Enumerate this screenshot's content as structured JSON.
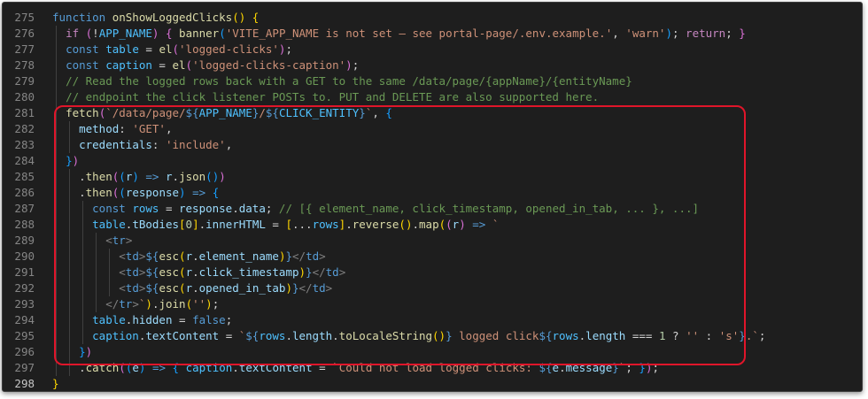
{
  "editor": {
    "current_line": "298",
    "lines": [
      {
        "n": "275",
        "tokens": [
          [
            "kw",
            "function "
          ],
          [
            "fn",
            "onShowLoggedClicks"
          ],
          [
            "p1",
            "()"
          ],
          [
            "op",
            " "
          ],
          [
            "p1",
            "{"
          ]
        ]
      },
      {
        "n": "276",
        "tokens": [
          [
            "op",
            "  "
          ],
          [
            "ctl",
            "if "
          ],
          [
            "p2",
            "("
          ],
          [
            "op",
            "!"
          ],
          [
            "cn",
            "APP_NAME"
          ],
          [
            "p2",
            ")"
          ],
          [
            "op",
            " "
          ],
          [
            "p2",
            "{"
          ],
          [
            "op",
            " "
          ],
          [
            "fn",
            "banner"
          ],
          [
            "p3",
            "("
          ],
          [
            "st",
            "'VITE_APP_NAME is not set — see portal-page/.env.example.'"
          ],
          [
            "op",
            ", "
          ],
          [
            "st",
            "'warn'"
          ],
          [
            "p3",
            ")"
          ],
          [
            "op",
            "; "
          ],
          [
            "ctl",
            "return"
          ],
          [
            "op",
            "; "
          ],
          [
            "p2",
            "}"
          ]
        ]
      },
      {
        "n": "277",
        "tokens": [
          [
            "op",
            "  "
          ],
          [
            "kw",
            "const "
          ],
          [
            "cn",
            "table"
          ],
          [
            "op",
            " = "
          ],
          [
            "fn",
            "el"
          ],
          [
            "p2",
            "("
          ],
          [
            "st",
            "'logged-clicks'"
          ],
          [
            "p2",
            ")"
          ],
          [
            "op",
            ";"
          ]
        ]
      },
      {
        "n": "278",
        "tokens": [
          [
            "op",
            "  "
          ],
          [
            "kw",
            "const "
          ],
          [
            "cn",
            "caption"
          ],
          [
            "op",
            " = "
          ],
          [
            "fn",
            "el"
          ],
          [
            "p2",
            "("
          ],
          [
            "st",
            "'logged-clicks-caption'"
          ],
          [
            "p2",
            ")"
          ],
          [
            "op",
            ";"
          ]
        ]
      },
      {
        "n": "279",
        "tokens": [
          [
            "op",
            "  "
          ],
          [
            "cm",
            "// Read the logged rows back with a GET to the same /data/page/{appName}/{entityName}"
          ]
        ]
      },
      {
        "n": "280",
        "tokens": [
          [
            "op",
            "  "
          ],
          [
            "cm",
            "// endpoint the click listener POSTs to. PUT and DELETE are also supported here."
          ]
        ]
      },
      {
        "n": "281",
        "tokens": [
          [
            "op",
            "  "
          ],
          [
            "fn",
            "fetch"
          ],
          [
            "p2",
            "("
          ],
          [
            "st",
            "`/data/page/"
          ],
          [
            "kw",
            "${"
          ],
          [
            "cn",
            "APP_NAME"
          ],
          [
            "kw",
            "}"
          ],
          [
            "st",
            "/"
          ],
          [
            "kw",
            "${"
          ],
          [
            "cn",
            "CLICK_ENTITY"
          ],
          [
            "kw",
            "}"
          ],
          [
            "st",
            "`"
          ],
          [
            "op",
            ", "
          ],
          [
            "p3",
            "{"
          ]
        ]
      },
      {
        "n": "282",
        "tokens": [
          [
            "op",
            "    "
          ],
          [
            "vr",
            "method"
          ],
          [
            "op",
            ": "
          ],
          [
            "st",
            "'GET'"
          ],
          [
            "op",
            ","
          ]
        ]
      },
      {
        "n": "283",
        "tokens": [
          [
            "op",
            "    "
          ],
          [
            "vr",
            "credentials"
          ],
          [
            "op",
            ": "
          ],
          [
            "st",
            "'include'"
          ],
          [
            "op",
            ","
          ]
        ]
      },
      {
        "n": "284",
        "tokens": [
          [
            "op",
            "  "
          ],
          [
            "p3",
            "}"
          ],
          [
            "p2",
            ")"
          ]
        ]
      },
      {
        "n": "285",
        "tokens": [
          [
            "op",
            "    ."
          ],
          [
            "fn",
            "then"
          ],
          [
            "p2",
            "("
          ],
          [
            "p3",
            "("
          ],
          [
            "vr",
            "r"
          ],
          [
            "p3",
            ")"
          ],
          [
            "op",
            " "
          ],
          [
            "kw",
            "=>"
          ],
          [
            "op",
            " "
          ],
          [
            "vr",
            "r"
          ],
          [
            "op",
            "."
          ],
          [
            "fn",
            "json"
          ],
          [
            "p3",
            "()"
          ],
          [
            "p2",
            ")"
          ]
        ]
      },
      {
        "n": "286",
        "tokens": [
          [
            "op",
            "    ."
          ],
          [
            "fn",
            "then"
          ],
          [
            "p2",
            "("
          ],
          [
            "p3",
            "("
          ],
          [
            "vr",
            "response"
          ],
          [
            "p3",
            ")"
          ],
          [
            "op",
            " "
          ],
          [
            "kw",
            "=>"
          ],
          [
            "op",
            " "
          ],
          [
            "p3",
            "{"
          ]
        ]
      },
      {
        "n": "287",
        "tokens": [
          [
            "op",
            "      "
          ],
          [
            "kw",
            "const "
          ],
          [
            "cn",
            "rows"
          ],
          [
            "op",
            " = "
          ],
          [
            "vr",
            "response"
          ],
          [
            "op",
            "."
          ],
          [
            "vr",
            "data"
          ],
          [
            "op",
            "; "
          ],
          [
            "cm",
            "// [{ element_name, click_timestamp, opened_in_tab, ... }, ...]"
          ]
        ]
      },
      {
        "n": "288",
        "tokens": [
          [
            "op",
            "      "
          ],
          [
            "cn",
            "table"
          ],
          [
            "op",
            "."
          ],
          [
            "vr",
            "tBodies"
          ],
          [
            "p1",
            "["
          ],
          [
            "nm",
            "0"
          ],
          [
            "p1",
            "]"
          ],
          [
            "op",
            "."
          ],
          [
            "vr",
            "innerHTML"
          ],
          [
            "op",
            " = "
          ],
          [
            "p1",
            "["
          ],
          [
            "op",
            "..."
          ],
          [
            "cn",
            "rows"
          ],
          [
            "p1",
            "]"
          ],
          [
            "op",
            "."
          ],
          [
            "fn",
            "reverse"
          ],
          [
            "p1",
            "()"
          ],
          [
            "op",
            "."
          ],
          [
            "fn",
            "map"
          ],
          [
            "p1",
            "("
          ],
          [
            "p2",
            "("
          ],
          [
            "vr",
            "r"
          ],
          [
            "p2",
            ")"
          ],
          [
            "op",
            " "
          ],
          [
            "kw",
            "=>"
          ],
          [
            "op",
            " "
          ],
          [
            "st",
            "`"
          ]
        ]
      },
      {
        "n": "289",
        "tokens": [
          [
            "op",
            "        "
          ],
          [
            "tgb",
            "<"
          ],
          [
            "tg",
            "tr"
          ],
          [
            "tgb",
            ">"
          ]
        ]
      },
      {
        "n": "290",
        "tokens": [
          [
            "op",
            "          "
          ],
          [
            "tgb",
            "<"
          ],
          [
            "tg",
            "td"
          ],
          [
            "tgb",
            ">"
          ],
          [
            "kw",
            "${"
          ],
          [
            "fn",
            "esc"
          ],
          [
            "p1",
            "("
          ],
          [
            "vr",
            "r"
          ],
          [
            "op",
            "."
          ],
          [
            "vr",
            "element_name"
          ],
          [
            "p1",
            ")"
          ],
          [
            "kw",
            "}"
          ],
          [
            "tgb",
            "</"
          ],
          [
            "tg",
            "td"
          ],
          [
            "tgb",
            ">"
          ]
        ]
      },
      {
        "n": "291",
        "tokens": [
          [
            "op",
            "          "
          ],
          [
            "tgb",
            "<"
          ],
          [
            "tg",
            "td"
          ],
          [
            "tgb",
            ">"
          ],
          [
            "kw",
            "${"
          ],
          [
            "fn",
            "esc"
          ],
          [
            "p1",
            "("
          ],
          [
            "vr",
            "r"
          ],
          [
            "op",
            "."
          ],
          [
            "vr",
            "click_timestamp"
          ],
          [
            "p1",
            ")"
          ],
          [
            "kw",
            "}"
          ],
          [
            "tgb",
            "</"
          ],
          [
            "tg",
            "td"
          ],
          [
            "tgb",
            ">"
          ]
        ]
      },
      {
        "n": "292",
        "tokens": [
          [
            "op",
            "          "
          ],
          [
            "tgb",
            "<"
          ],
          [
            "tg",
            "td"
          ],
          [
            "tgb",
            ">"
          ],
          [
            "kw",
            "${"
          ],
          [
            "fn",
            "esc"
          ],
          [
            "p1",
            "("
          ],
          [
            "vr",
            "r"
          ],
          [
            "op",
            "."
          ],
          [
            "vr",
            "opened_in_tab"
          ],
          [
            "p1",
            ")"
          ],
          [
            "kw",
            "}"
          ],
          [
            "tgb",
            "</"
          ],
          [
            "tg",
            "td"
          ],
          [
            "tgb",
            ">"
          ]
        ]
      },
      {
        "n": "293",
        "tokens": [
          [
            "op",
            "        "
          ],
          [
            "tgb",
            "</"
          ],
          [
            "tg",
            "tr"
          ],
          [
            "tgb",
            ">"
          ],
          [
            "st",
            "`"
          ],
          [
            "p1",
            ")"
          ],
          [
            "op",
            "."
          ],
          [
            "fn",
            "join"
          ],
          [
            "p1",
            "("
          ],
          [
            "st",
            "''"
          ],
          [
            "p1",
            ")"
          ],
          [
            "op",
            ";"
          ]
        ]
      },
      {
        "n": "294",
        "tokens": [
          [
            "op",
            "      "
          ],
          [
            "cn",
            "table"
          ],
          [
            "op",
            "."
          ],
          [
            "vr",
            "hidden"
          ],
          [
            "op",
            " = "
          ],
          [
            "kw",
            "false"
          ],
          [
            "op",
            ";"
          ]
        ]
      },
      {
        "n": "295",
        "tokens": [
          [
            "op",
            "      "
          ],
          [
            "cn",
            "caption"
          ],
          [
            "op",
            "."
          ],
          [
            "vr",
            "textContent"
          ],
          [
            "op",
            " = "
          ],
          [
            "st",
            "`"
          ],
          [
            "kw",
            "${"
          ],
          [
            "cn",
            "rows"
          ],
          [
            "op",
            "."
          ],
          [
            "vr",
            "length"
          ],
          [
            "op",
            "."
          ],
          [
            "fn",
            "toLocaleString"
          ],
          [
            "p1",
            "()"
          ],
          [
            "kw",
            "}"
          ],
          [
            "st",
            " logged click"
          ],
          [
            "kw",
            "${"
          ],
          [
            "cn",
            "rows"
          ],
          [
            "op",
            "."
          ],
          [
            "vr",
            "length"
          ],
          [
            "op",
            " === "
          ],
          [
            "nm",
            "1"
          ],
          [
            "op",
            " ? "
          ],
          [
            "st",
            "''"
          ],
          [
            "op",
            " : "
          ],
          [
            "st",
            "'s'"
          ],
          [
            "kw",
            "}"
          ],
          [
            "st",
            ".`"
          ],
          [
            "op",
            ";"
          ]
        ]
      },
      {
        "n": "296",
        "tokens": [
          [
            "op",
            "    "
          ],
          [
            "p3",
            "}"
          ],
          [
            "p2",
            ")"
          ]
        ]
      },
      {
        "n": "297",
        "tokens": [
          [
            "op",
            "    ."
          ],
          [
            "fn",
            "catch"
          ],
          [
            "p2",
            "("
          ],
          [
            "p3",
            "("
          ],
          [
            "vr",
            "e"
          ],
          [
            "p3",
            ")"
          ],
          [
            "op",
            " "
          ],
          [
            "kw",
            "=>"
          ],
          [
            "op",
            " "
          ],
          [
            "p3",
            "{"
          ],
          [
            "op",
            " "
          ],
          [
            "cn",
            "caption"
          ],
          [
            "op",
            "."
          ],
          [
            "vr",
            "textContent"
          ],
          [
            "op",
            " = "
          ],
          [
            "st",
            "`Could not load logged clicks: "
          ],
          [
            "kw",
            "${"
          ],
          [
            "vr",
            "e"
          ],
          [
            "op",
            "."
          ],
          [
            "vr",
            "message"
          ],
          [
            "kw",
            "}"
          ],
          [
            "st",
            "`"
          ],
          [
            "op",
            "; "
          ],
          [
            "p3",
            "}"
          ],
          [
            "p2",
            ")"
          ],
          [
            "op",
            ";"
          ]
        ]
      },
      {
        "n": "298",
        "tokens": [
          [
            "p1",
            "}"
          ]
        ]
      }
    ]
  }
}
